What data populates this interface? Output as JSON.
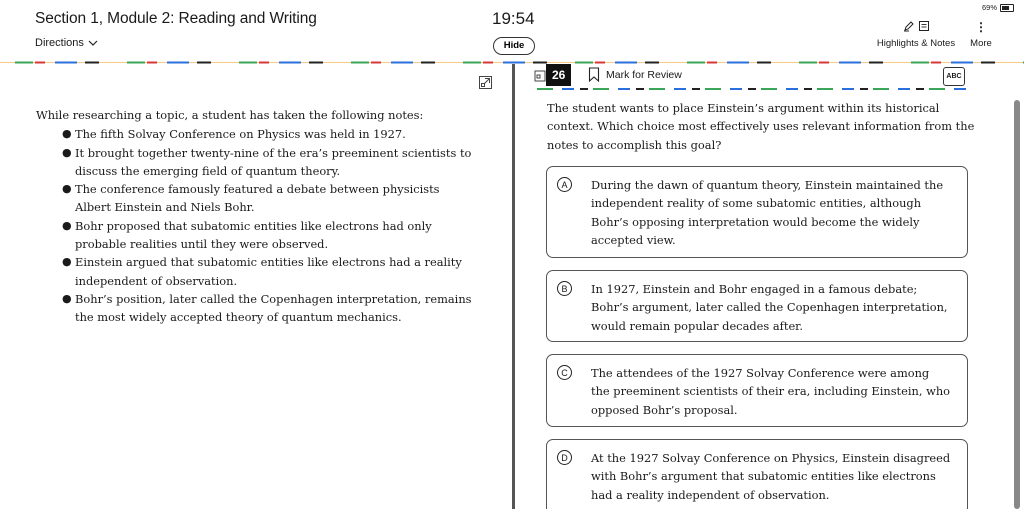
{
  "header": {
    "section_title": "Section 1, Module 2: Reading and Writing",
    "directions_label": "Directions",
    "timer": "19:54",
    "hide_label": "Hide",
    "battery": "69%",
    "highlights_label": "Highlights & Notes",
    "more_label": "More"
  },
  "passage": {
    "intro": "While researching a topic, a student has taken the following notes:",
    "bullets": [
      "The fifth Solvay Conference on Physics was held in 1927.",
      "It brought together twenty-nine of the era’s preeminent scientists to discuss the emerging field of quantum theory.",
      "The conference famously featured a debate between physicists Albert Einstein and Niels Bohr.",
      "Bohr proposed that subatomic entities like electrons had only probable realities until they were observed.",
      "Einstein argued that subatomic entities like electrons had a reality independent of observation.",
      "Bohr’s position, later called the Copenhagen interpretation, remains the most widely accepted theory of quantum mechanics."
    ]
  },
  "question": {
    "number": "26",
    "mark_label": "Mark for Review",
    "abc_label": "ABC",
    "prompt": "The student wants to place Einstein’s argument within its historical context. Which choice most effectively uses relevant information from the notes to accomplish this goal?",
    "choices": [
      {
        "letter": "A",
        "text": "During the dawn of quantum theory, Einstein maintained the independent reality of some subatomic entities, although Bohr’s opposing interpretation would become the widely accepted view."
      },
      {
        "letter": "B",
        "text": "In 1927, Einstein and Bohr engaged in a famous debate; Bohr’s argument, later called the Copenhagen interpretation, would remain popular decades after."
      },
      {
        "letter": "C",
        "text": "The attendees of the 1927 Solvay Conference were among the preeminent scientists of their era, including Einstein, who opposed Bohr’s proposal."
      },
      {
        "letter": "D",
        "text": "At the 1927 Solvay Conference on Physics, Einstein disagreed with Bohr’s argument that subatomic entities like electrons had a reality independent of observation."
      }
    ]
  },
  "icons": {
    "directions": "chevron-down-icon",
    "highlight": "pen-icon",
    "notes": "notepad-icon",
    "more": "more-vertical-icon",
    "expand": "expand-icon",
    "bookmark": "bookmark-icon",
    "eliminator": "abc-eliminator-icon"
  },
  "colors": {
    "dash_colors": [
      "#2a6fdb",
      "#f0a020",
      "#3aa65a",
      "#d43a3a",
      "#222222"
    ],
    "question_number_bg": "#111111",
    "splitter": "#555555"
  }
}
